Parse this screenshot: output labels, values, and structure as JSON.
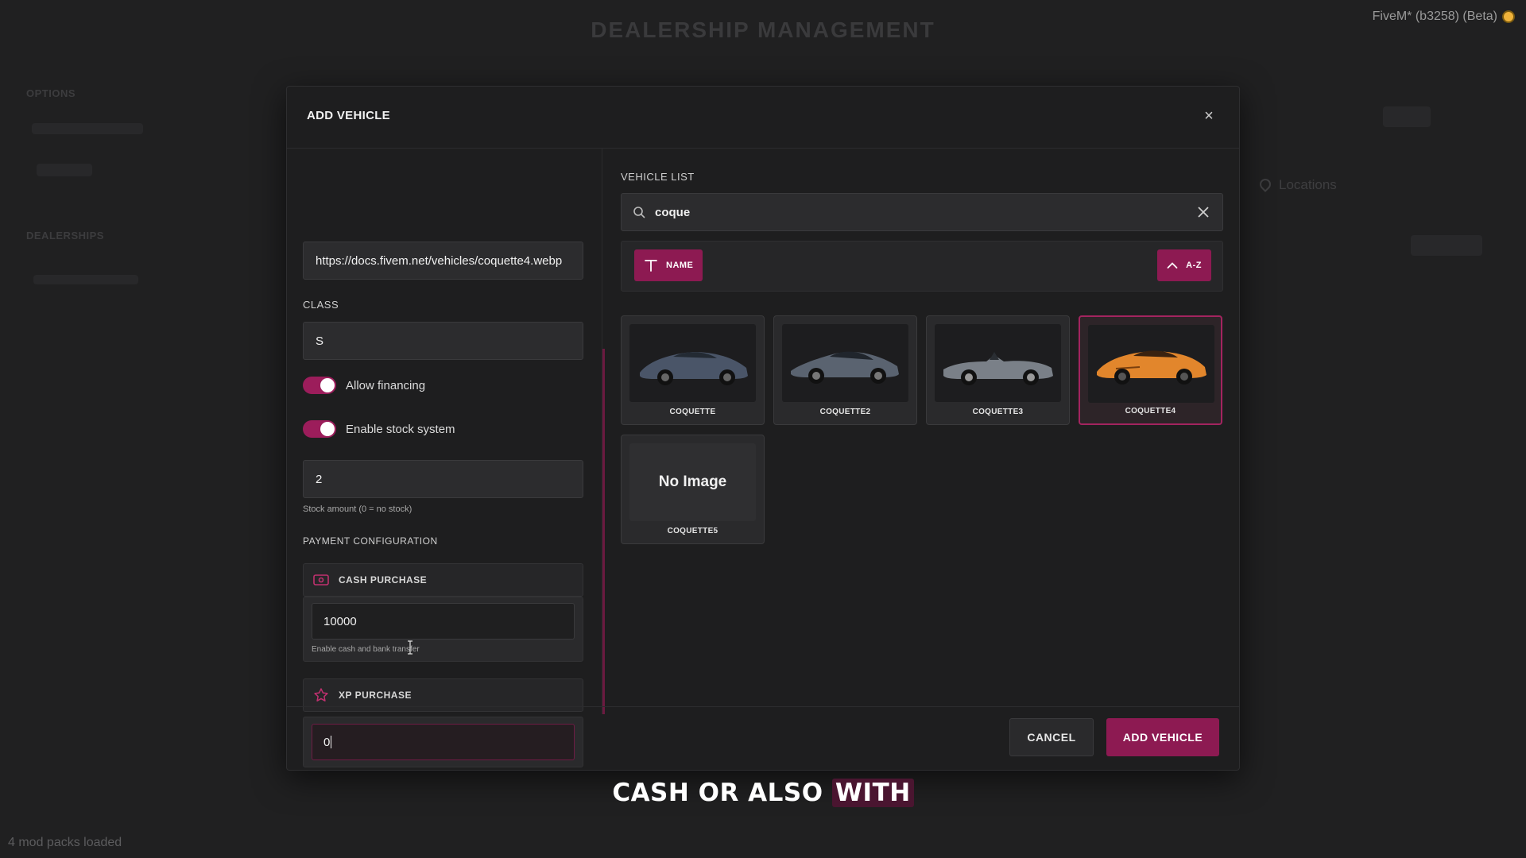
{
  "background": {
    "title": "DEALERSHIP MANAGEMENT",
    "fivem_label": "FiveM* (b3258) (Beta)",
    "options_label": "OPTIONS",
    "dealerships_label": "DEALERSHIPS",
    "locations_label": "Locations",
    "status": "4 mod packs loaded"
  },
  "modal": {
    "title": "ADD VEHICLE",
    "close_glyph": "×",
    "left": {
      "url_value": "https://docs.fivem.net/vehicles/coquette4.webp",
      "class_label": "CLASS",
      "class_value": "S",
      "allow_financing_label": "Allow financing",
      "stock_system_label": "Enable stock system",
      "stock_value": "2",
      "stock_hint": "Stock amount (0 = no stock)",
      "payment_label": "PAYMENT CONFIGURATION",
      "cash": {
        "label": "CASH PURCHASE",
        "value": "10000",
        "hint": "Enable cash and bank transfer"
      },
      "xp": {
        "label": "XP PURCHASE",
        "value": "0"
      }
    },
    "right": {
      "section_label": "VEHICLE LIST",
      "search_value": "coque",
      "sort_name_label": "NAME",
      "sort_order_label": "A-Z",
      "vehicles": [
        {
          "name": "COQUETTE",
          "color": "#4a5568",
          "image": true
        },
        {
          "name": "COQUETTE2",
          "color": "#5a6370",
          "image": true
        },
        {
          "name": "COQUETTE3",
          "color": "#7a8088",
          "image": true
        },
        {
          "name": "COQUETTE4",
          "color": "#e2862c",
          "image": true
        },
        {
          "name": "COQUETTE5",
          "image": false,
          "placeholder": "No Image"
        }
      ]
    },
    "footer": {
      "cancel_label": "CANCEL",
      "add_label": "ADD VEHICLE"
    }
  },
  "subtitle": {
    "part1": "CASH OR ALSO ",
    "part2": "WITH"
  },
  "colors": {
    "accent": "#8d1a52",
    "selected_border": "#a3245f"
  }
}
